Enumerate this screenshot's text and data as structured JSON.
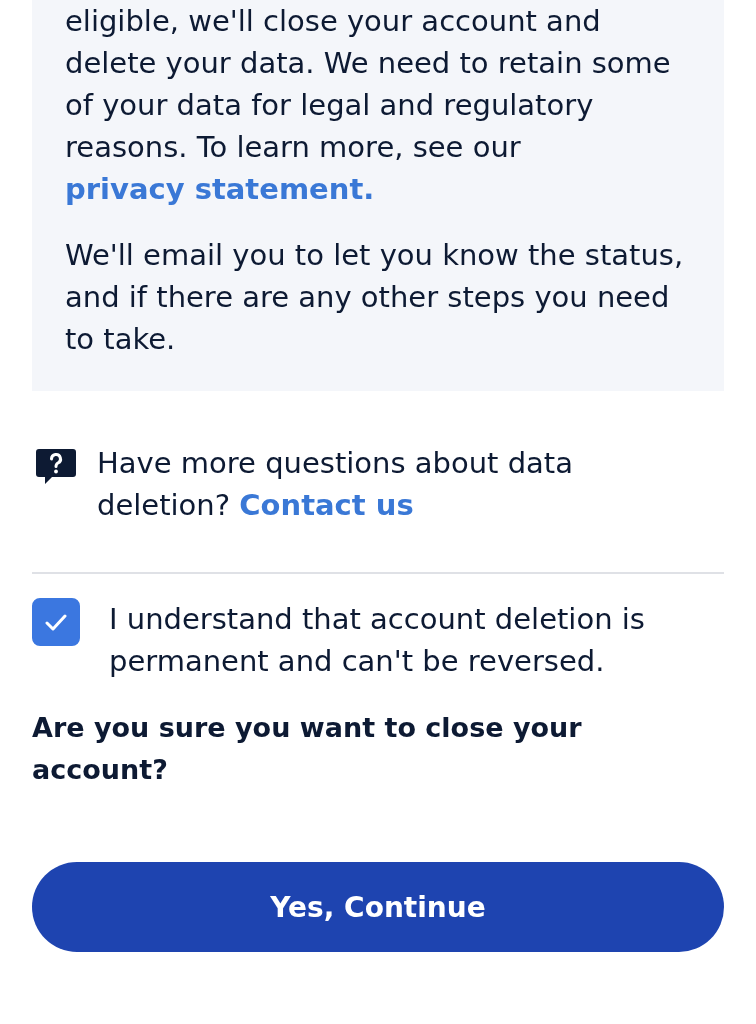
{
  "notice": {
    "paragraphs": [
      {
        "text": "eligible, we'll close your account and delete your data. We need to retain some of your data for legal and regulatory reasons. To learn more, see our",
        "link": "privacy statement."
      },
      {
        "text": "We'll email you to let you know the status, and if there are any other steps you need to take."
      }
    ]
  },
  "help": {
    "text": "Have more questions about data deletion?",
    "link": "Contact us"
  },
  "confirmation": {
    "checked": true,
    "label": "I understand that account deletion is permanent and can't be reversed."
  },
  "question": "Are you sure you want to close your account?",
  "primary_button": {
    "label": "Yes, Continue"
  }
}
